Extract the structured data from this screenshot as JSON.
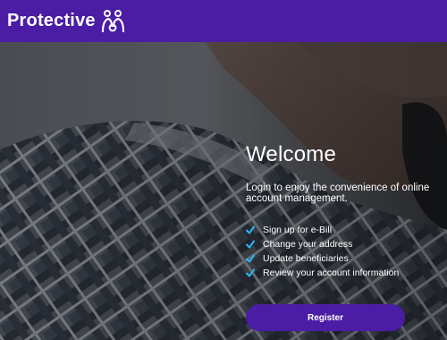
{
  "header": {
    "brand": "Protective",
    "logo_icon": "family-figures-icon",
    "background_color": "#4b1ca4"
  },
  "hero": {
    "title": "Welcome",
    "intro": "Login to enjoy the convenience of online account management.",
    "features": [
      {
        "icon": "check-icon",
        "label": "Sign up for e-Bill"
      },
      {
        "icon": "check-icon",
        "label": "Change your address"
      },
      {
        "icon": "check-icon",
        "label": "Update beneficiaries"
      },
      {
        "icon": "check-icon",
        "label": "Review your account information"
      }
    ],
    "check_color": "#29b6f6"
  },
  "actions": {
    "register_label": "Register",
    "button_color": "#4b1ca4"
  }
}
